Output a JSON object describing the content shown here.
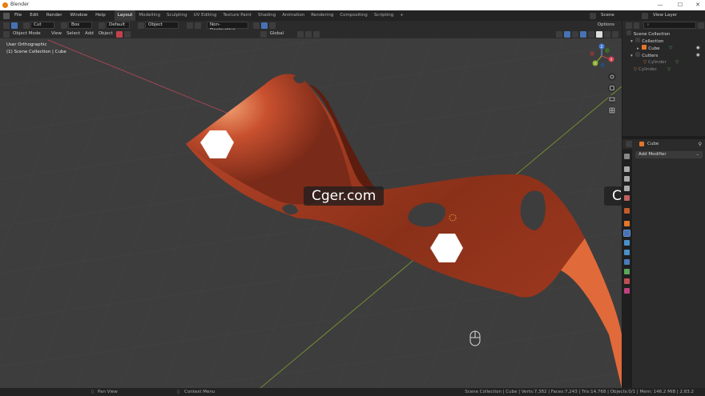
{
  "window": {
    "title": "Blender",
    "minimize": "—",
    "maximize": "☐",
    "close": "✕"
  },
  "menu": [
    "File",
    "Edit",
    "Render",
    "Window",
    "Help"
  ],
  "workspaces": [
    "Layout",
    "Modelling",
    "Sculpting",
    "UV Editing",
    "Texture Paint",
    "Shading",
    "Animation",
    "Rendering",
    "Compositing",
    "Scripting"
  ],
  "workspace_add": "+",
  "scene": {
    "label": "Scene"
  },
  "view_layer": {
    "label": "View Layer"
  },
  "toolbar": {
    "operation": "Cut",
    "select_mode": "Box",
    "brush": "Default",
    "target": "Object",
    "solver": "Non-Destructive",
    "options": "Options"
  },
  "viewport_header": {
    "mode": "Object Mode",
    "menus": [
      "View",
      "Select",
      "Add",
      "Object"
    ],
    "orientation": "Global"
  },
  "viewport": {
    "view_name": "User Orthographic",
    "collection_info": "(1) Scene Collection | Cube",
    "gizmo": {
      "x": "X",
      "y": "Y",
      "z": "Z"
    }
  },
  "watermarks": [
    "Cger.com",
    "Cger.com"
  ],
  "outliner": {
    "search_placeholder": "",
    "rows": [
      {
        "label": "Scene Collection",
        "indent": 0
      },
      {
        "label": "Collection",
        "indent": 1
      },
      {
        "label": "Cube",
        "indent": 2
      },
      {
        "label": "Cutters",
        "indent": 1
      },
      {
        "label": "Cylinder",
        "indent": 2
      },
      {
        "label": "Cylinder",
        "indent": 1
      }
    ]
  },
  "properties": {
    "object_name": "Cube",
    "add_modifier": "Add Modifier"
  },
  "status": {
    "left_hint": "Pan View",
    "mid_hint": "Context Menu",
    "stats": "Scene Collection | Cube | Verts:7,382 | Faces:7,243 | Tris:14,768 | Objects:0/1 | Mem: 146.2 MiB | 2.83.2"
  },
  "colors": {
    "accent": "#4772b3",
    "object_orange": "#e3762a",
    "mesh_green": "#5aa65a",
    "mesh_surface": "#b8452c",
    "axis_red": "#c2414d",
    "axis_green": "#8ab033"
  }
}
